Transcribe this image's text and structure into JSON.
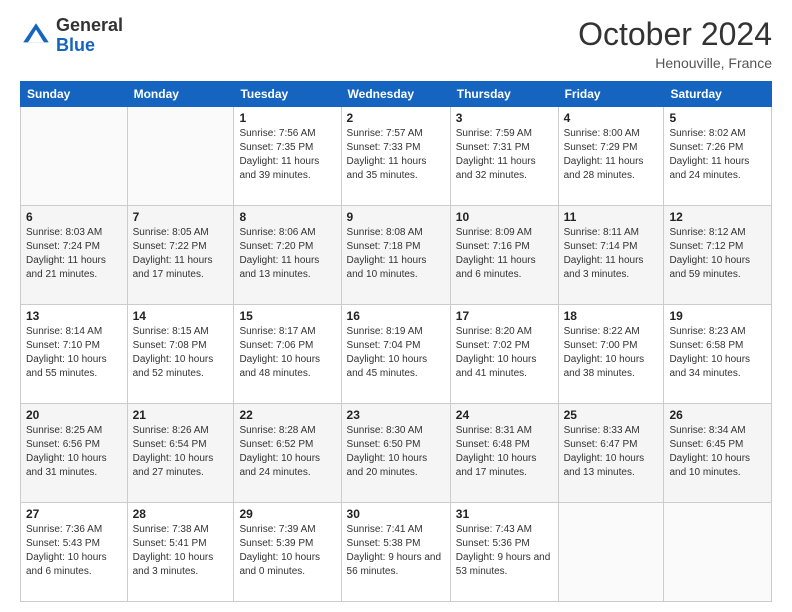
{
  "header": {
    "logo_general": "General",
    "logo_blue": "Blue",
    "month_title": "October 2024",
    "subtitle": "Henouville, France"
  },
  "days_of_week": [
    "Sunday",
    "Monday",
    "Tuesday",
    "Wednesday",
    "Thursday",
    "Friday",
    "Saturday"
  ],
  "weeks": [
    [
      {
        "day": "",
        "sunrise": "",
        "sunset": "",
        "daylight": ""
      },
      {
        "day": "",
        "sunrise": "",
        "sunset": "",
        "daylight": ""
      },
      {
        "day": "1",
        "sunrise": "Sunrise: 7:56 AM",
        "sunset": "Sunset: 7:35 PM",
        "daylight": "Daylight: 11 hours and 39 minutes."
      },
      {
        "day": "2",
        "sunrise": "Sunrise: 7:57 AM",
        "sunset": "Sunset: 7:33 PM",
        "daylight": "Daylight: 11 hours and 35 minutes."
      },
      {
        "day": "3",
        "sunrise": "Sunrise: 7:59 AM",
        "sunset": "Sunset: 7:31 PM",
        "daylight": "Daylight: 11 hours and 32 minutes."
      },
      {
        "day": "4",
        "sunrise": "Sunrise: 8:00 AM",
        "sunset": "Sunset: 7:29 PM",
        "daylight": "Daylight: 11 hours and 28 minutes."
      },
      {
        "day": "5",
        "sunrise": "Sunrise: 8:02 AM",
        "sunset": "Sunset: 7:26 PM",
        "daylight": "Daylight: 11 hours and 24 minutes."
      }
    ],
    [
      {
        "day": "6",
        "sunrise": "Sunrise: 8:03 AM",
        "sunset": "Sunset: 7:24 PM",
        "daylight": "Daylight: 11 hours and 21 minutes."
      },
      {
        "day": "7",
        "sunrise": "Sunrise: 8:05 AM",
        "sunset": "Sunset: 7:22 PM",
        "daylight": "Daylight: 11 hours and 17 minutes."
      },
      {
        "day": "8",
        "sunrise": "Sunrise: 8:06 AM",
        "sunset": "Sunset: 7:20 PM",
        "daylight": "Daylight: 11 hours and 13 minutes."
      },
      {
        "day": "9",
        "sunrise": "Sunrise: 8:08 AM",
        "sunset": "Sunset: 7:18 PM",
        "daylight": "Daylight: 11 hours and 10 minutes."
      },
      {
        "day": "10",
        "sunrise": "Sunrise: 8:09 AM",
        "sunset": "Sunset: 7:16 PM",
        "daylight": "Daylight: 11 hours and 6 minutes."
      },
      {
        "day": "11",
        "sunrise": "Sunrise: 8:11 AM",
        "sunset": "Sunset: 7:14 PM",
        "daylight": "Daylight: 11 hours and 3 minutes."
      },
      {
        "day": "12",
        "sunrise": "Sunrise: 8:12 AM",
        "sunset": "Sunset: 7:12 PM",
        "daylight": "Daylight: 10 hours and 59 minutes."
      }
    ],
    [
      {
        "day": "13",
        "sunrise": "Sunrise: 8:14 AM",
        "sunset": "Sunset: 7:10 PM",
        "daylight": "Daylight: 10 hours and 55 minutes."
      },
      {
        "day": "14",
        "sunrise": "Sunrise: 8:15 AM",
        "sunset": "Sunset: 7:08 PM",
        "daylight": "Daylight: 10 hours and 52 minutes."
      },
      {
        "day": "15",
        "sunrise": "Sunrise: 8:17 AM",
        "sunset": "Sunset: 7:06 PM",
        "daylight": "Daylight: 10 hours and 48 minutes."
      },
      {
        "day": "16",
        "sunrise": "Sunrise: 8:19 AM",
        "sunset": "Sunset: 7:04 PM",
        "daylight": "Daylight: 10 hours and 45 minutes."
      },
      {
        "day": "17",
        "sunrise": "Sunrise: 8:20 AM",
        "sunset": "Sunset: 7:02 PM",
        "daylight": "Daylight: 10 hours and 41 minutes."
      },
      {
        "day": "18",
        "sunrise": "Sunrise: 8:22 AM",
        "sunset": "Sunset: 7:00 PM",
        "daylight": "Daylight: 10 hours and 38 minutes."
      },
      {
        "day": "19",
        "sunrise": "Sunrise: 8:23 AM",
        "sunset": "Sunset: 6:58 PM",
        "daylight": "Daylight: 10 hours and 34 minutes."
      }
    ],
    [
      {
        "day": "20",
        "sunrise": "Sunrise: 8:25 AM",
        "sunset": "Sunset: 6:56 PM",
        "daylight": "Daylight: 10 hours and 31 minutes."
      },
      {
        "day": "21",
        "sunrise": "Sunrise: 8:26 AM",
        "sunset": "Sunset: 6:54 PM",
        "daylight": "Daylight: 10 hours and 27 minutes."
      },
      {
        "day": "22",
        "sunrise": "Sunrise: 8:28 AM",
        "sunset": "Sunset: 6:52 PM",
        "daylight": "Daylight: 10 hours and 24 minutes."
      },
      {
        "day": "23",
        "sunrise": "Sunrise: 8:30 AM",
        "sunset": "Sunset: 6:50 PM",
        "daylight": "Daylight: 10 hours and 20 minutes."
      },
      {
        "day": "24",
        "sunrise": "Sunrise: 8:31 AM",
        "sunset": "Sunset: 6:48 PM",
        "daylight": "Daylight: 10 hours and 17 minutes."
      },
      {
        "day": "25",
        "sunrise": "Sunrise: 8:33 AM",
        "sunset": "Sunset: 6:47 PM",
        "daylight": "Daylight: 10 hours and 13 minutes."
      },
      {
        "day": "26",
        "sunrise": "Sunrise: 8:34 AM",
        "sunset": "Sunset: 6:45 PM",
        "daylight": "Daylight: 10 hours and 10 minutes."
      }
    ],
    [
      {
        "day": "27",
        "sunrise": "Sunrise: 7:36 AM",
        "sunset": "Sunset: 5:43 PM",
        "daylight": "Daylight: 10 hours and 6 minutes."
      },
      {
        "day": "28",
        "sunrise": "Sunrise: 7:38 AM",
        "sunset": "Sunset: 5:41 PM",
        "daylight": "Daylight: 10 hours and 3 minutes."
      },
      {
        "day": "29",
        "sunrise": "Sunrise: 7:39 AM",
        "sunset": "Sunset: 5:39 PM",
        "daylight": "Daylight: 10 hours and 0 minutes."
      },
      {
        "day": "30",
        "sunrise": "Sunrise: 7:41 AM",
        "sunset": "Sunset: 5:38 PM",
        "daylight": "Daylight: 9 hours and 56 minutes."
      },
      {
        "day": "31",
        "sunrise": "Sunrise: 7:43 AM",
        "sunset": "Sunset: 5:36 PM",
        "daylight": "Daylight: 9 hours and 53 minutes."
      },
      {
        "day": "",
        "sunrise": "",
        "sunset": "",
        "daylight": ""
      },
      {
        "day": "",
        "sunrise": "",
        "sunset": "",
        "daylight": ""
      }
    ]
  ]
}
